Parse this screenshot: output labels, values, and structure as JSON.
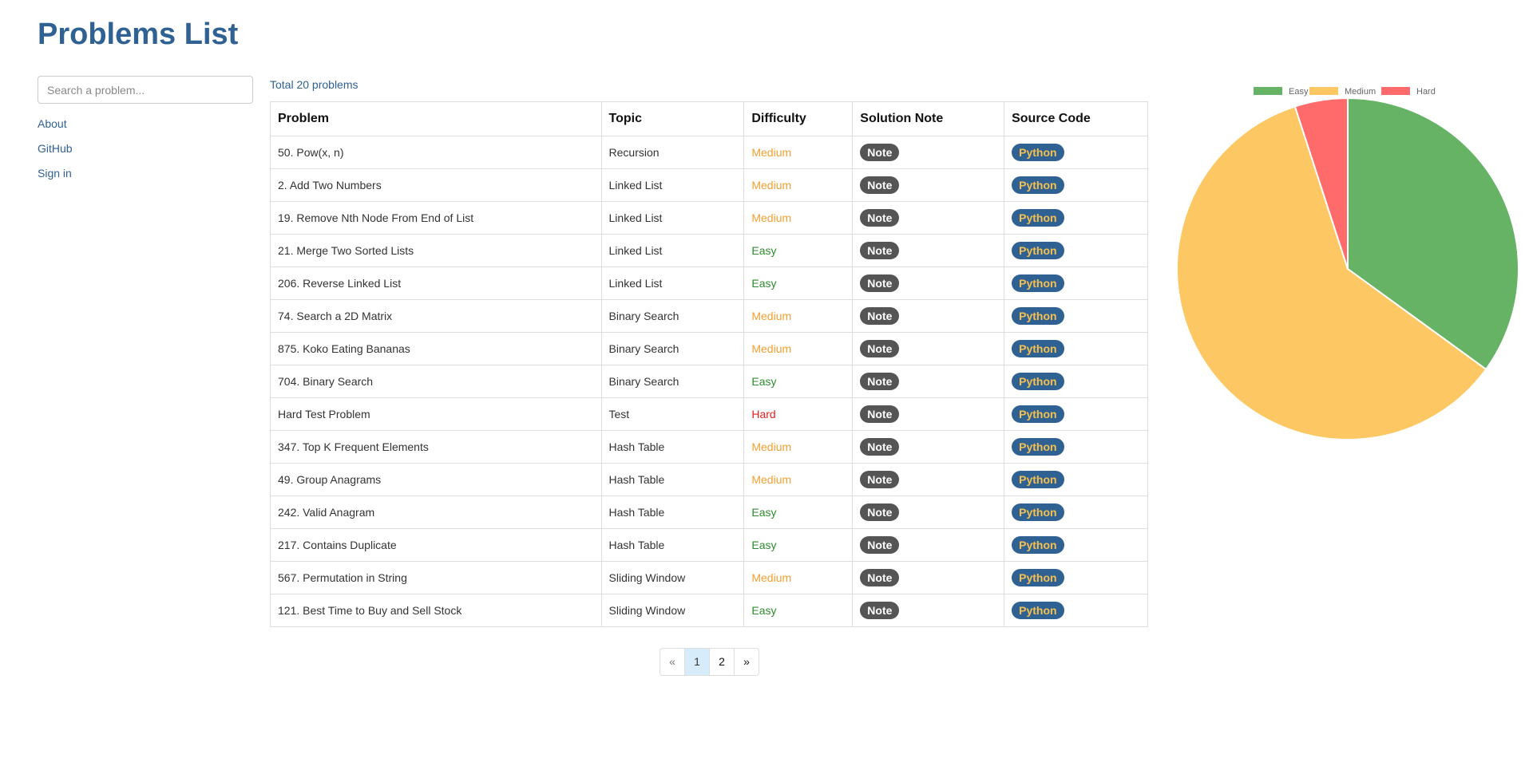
{
  "page": {
    "title": "Problems List"
  },
  "sidebar": {
    "search_placeholder": "Search a problem...",
    "links": [
      "About",
      "GitHub",
      "Sign in"
    ]
  },
  "main": {
    "total_text": "Total 20 problems",
    "columns": [
      "Problem",
      "Topic",
      "Difficulty",
      "Solution Note",
      "Source Code"
    ],
    "note_label": "Note",
    "code_label": "Python",
    "rows": [
      {
        "problem": "50. Pow(x, n)",
        "topic": "Recursion",
        "difficulty": "Medium"
      },
      {
        "problem": "2. Add Two Numbers",
        "topic": "Linked List",
        "difficulty": "Medium"
      },
      {
        "problem": "19. Remove Nth Node From End of List",
        "topic": "Linked List",
        "difficulty": "Medium"
      },
      {
        "problem": "21. Merge Two Sorted Lists",
        "topic": "Linked List",
        "difficulty": "Easy"
      },
      {
        "problem": "206. Reverse Linked List",
        "topic": "Linked List",
        "difficulty": "Easy"
      },
      {
        "problem": "74. Search a 2D Matrix",
        "topic": "Binary Search",
        "difficulty": "Medium"
      },
      {
        "problem": "875. Koko Eating Bananas",
        "topic": "Binary Search",
        "difficulty": "Medium"
      },
      {
        "problem": "704. Binary Search",
        "topic": "Binary Search",
        "difficulty": "Easy"
      },
      {
        "problem": "Hard Test Problem",
        "topic": "Test",
        "difficulty": "Hard"
      },
      {
        "problem": "347. Top K Frequent Elements",
        "topic": "Hash Table",
        "difficulty": "Medium"
      },
      {
        "problem": "49. Group Anagrams",
        "topic": "Hash Table",
        "difficulty": "Medium"
      },
      {
        "problem": "242. Valid Anagram",
        "topic": "Hash Table",
        "difficulty": "Easy"
      },
      {
        "problem": "217. Contains Duplicate",
        "topic": "Hash Table",
        "difficulty": "Easy"
      },
      {
        "problem": "567. Permutation in String",
        "topic": "Sliding Window",
        "difficulty": "Medium"
      },
      {
        "problem": "121. Best Time to Buy and Sell Stock",
        "topic": "Sliding Window",
        "difficulty": "Easy"
      }
    ]
  },
  "pagination": {
    "prev": "«",
    "pages": [
      "1",
      "2"
    ],
    "next": "»",
    "current": "1"
  },
  "colors": {
    "easy": "#66b366",
    "medium": "#fdc863",
    "hard": "#ff6b6b"
  },
  "chart_data": {
    "type": "pie",
    "categories": [
      "Easy",
      "Medium",
      "Hard"
    ],
    "values": [
      7,
      12,
      1
    ],
    "legend": "top"
  }
}
